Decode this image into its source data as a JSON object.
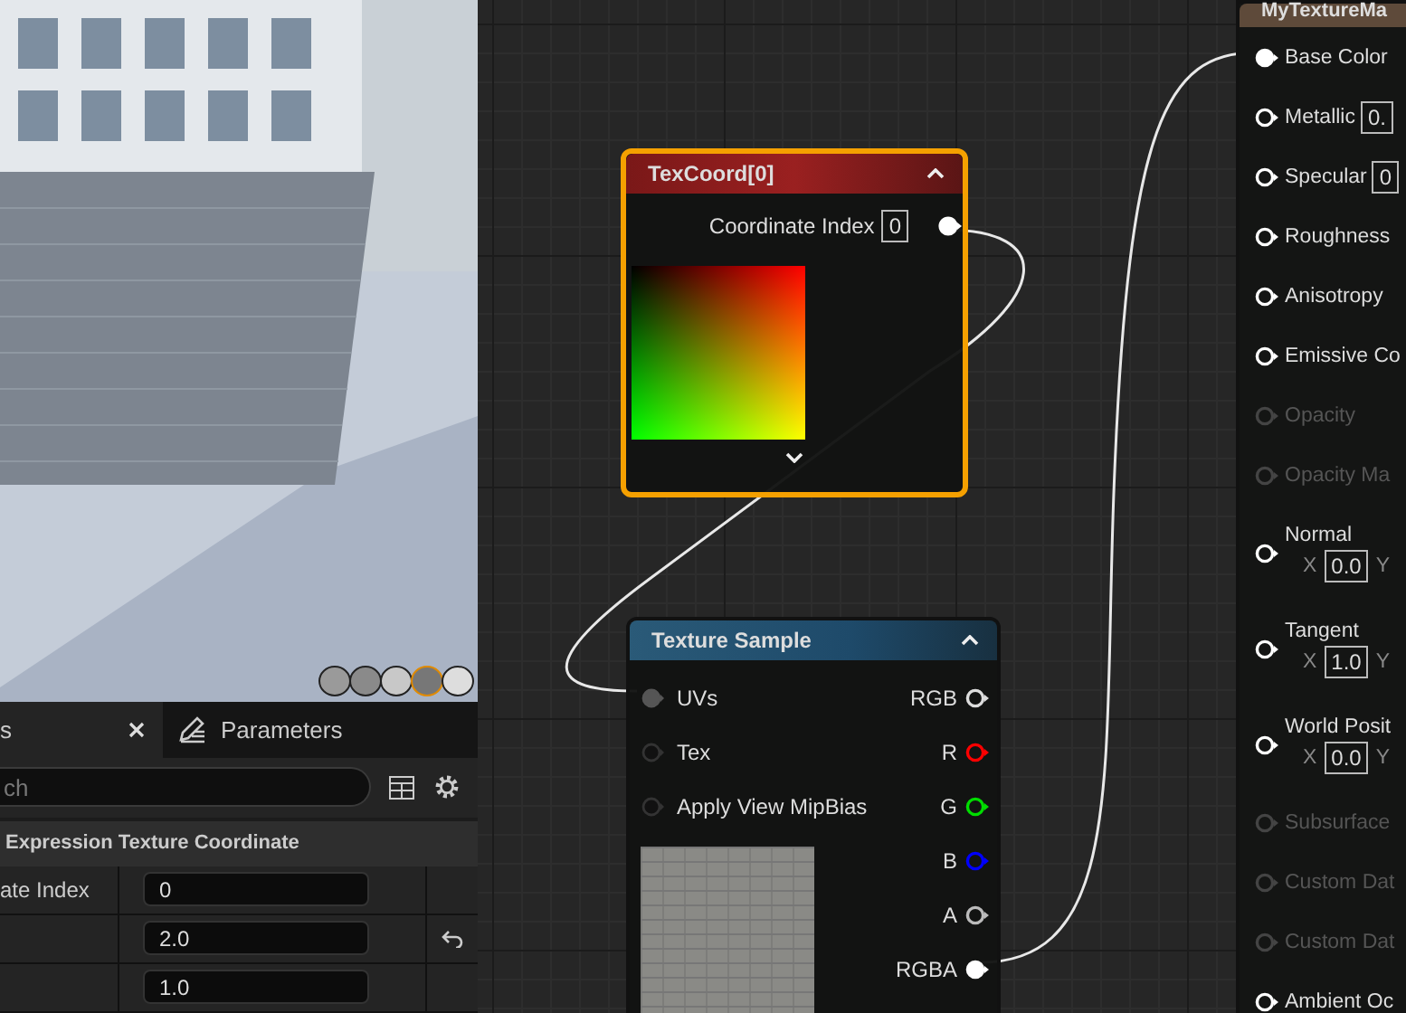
{
  "viewport": {
    "preview_shapes": [
      {
        "kind": "cylinder",
        "selected": false
      },
      {
        "kind": "sphere",
        "selected": false
      },
      {
        "kind": "plane",
        "selected": false
      },
      {
        "kind": "cube",
        "selected": true
      },
      {
        "kind": "mesh",
        "selected": false
      }
    ]
  },
  "details": {
    "tabs": [
      {
        "label": "s",
        "closable": true,
        "has_icon": false,
        "selected": true
      },
      {
        "label": "Parameters",
        "closable": false,
        "has_icon": true,
        "selected": false
      }
    ],
    "search": {
      "placeholder": "ch"
    },
    "section": "Expression Texture Coordinate",
    "rows": [
      {
        "name": "ate Index",
        "value": "0",
        "resettable": false
      },
      {
        "value": "2.0",
        "resettable": true
      },
      {
        "value": "1.0",
        "resettable": false
      }
    ]
  },
  "graph": {
    "texcoord_node": {
      "title": "TexCoord[0]",
      "selected": true,
      "pin_label": "Coordinate Index",
      "pin_value": "0",
      "output_connected": true
    },
    "texture_sample_node": {
      "title": "Texture Sample",
      "selected": false,
      "inputs": [
        {
          "label": "UVs",
          "connected": true
        },
        {
          "label": "Tex",
          "connected": false
        },
        {
          "label": "Apply View MipBias",
          "connected": false
        }
      ],
      "outputs": [
        {
          "label": "RGB",
          "color": "#dddddd",
          "connected": false
        },
        {
          "label": "R",
          "color": "#ff0000",
          "connected": false
        },
        {
          "label": "G",
          "color": "#00dd00",
          "connected": false
        },
        {
          "label": "B",
          "color": "#0000ff",
          "connected": false
        },
        {
          "label": "A",
          "color": "#bbbbbb",
          "connected": false
        },
        {
          "label": "RGBA",
          "color": "#ffffff",
          "connected": true
        }
      ]
    },
    "material_node": {
      "title": "MyTextureMa",
      "pins": [
        {
          "kind": "plain",
          "label": "Base Color",
          "connected": true,
          "disabled": false
        },
        {
          "kind": "scalar",
          "label": "Metallic",
          "value": "0.",
          "connected": false,
          "disabled": false
        },
        {
          "kind": "scalar",
          "label": "Specular",
          "value": "0",
          "connected": false,
          "disabled": false
        },
        {
          "kind": "plain",
          "label": "Roughness",
          "connected": false,
          "disabled": false
        },
        {
          "kind": "plain",
          "label": "Anisotropy",
          "connected": false,
          "disabled": false
        },
        {
          "kind": "plain",
          "label": "Emissive Co",
          "connected": false,
          "disabled": false
        },
        {
          "kind": "plain",
          "label": "Opacity",
          "connected": false,
          "disabled": true
        },
        {
          "kind": "plain",
          "label": "Opacity Ma",
          "connected": false,
          "disabled": true
        },
        {
          "kind": "vector",
          "label": "Normal",
          "x_label": "X",
          "x_value": "0.0",
          "y_label": "Y",
          "connected": false,
          "disabled": false
        },
        {
          "kind": "vector",
          "label": "Tangent",
          "x_label": "X",
          "x_value": "1.0",
          "y_label": "Y",
          "connected": false,
          "disabled": false
        },
        {
          "kind": "vector",
          "label": "World Posit",
          "x_label": "X",
          "x_value": "0.0",
          "y_label": "Y",
          "connected": false,
          "disabled": false
        },
        {
          "kind": "plain",
          "label": "Subsurface",
          "connected": false,
          "disabled": true
        },
        {
          "kind": "plain",
          "label": "Custom Dat",
          "connected": false,
          "disabled": true
        },
        {
          "kind": "plain",
          "label": "Custom Dat",
          "connected": false,
          "disabled": true
        },
        {
          "kind": "plain",
          "label": "Ambient Oc",
          "connected": false,
          "disabled": false
        }
      ]
    }
  }
}
